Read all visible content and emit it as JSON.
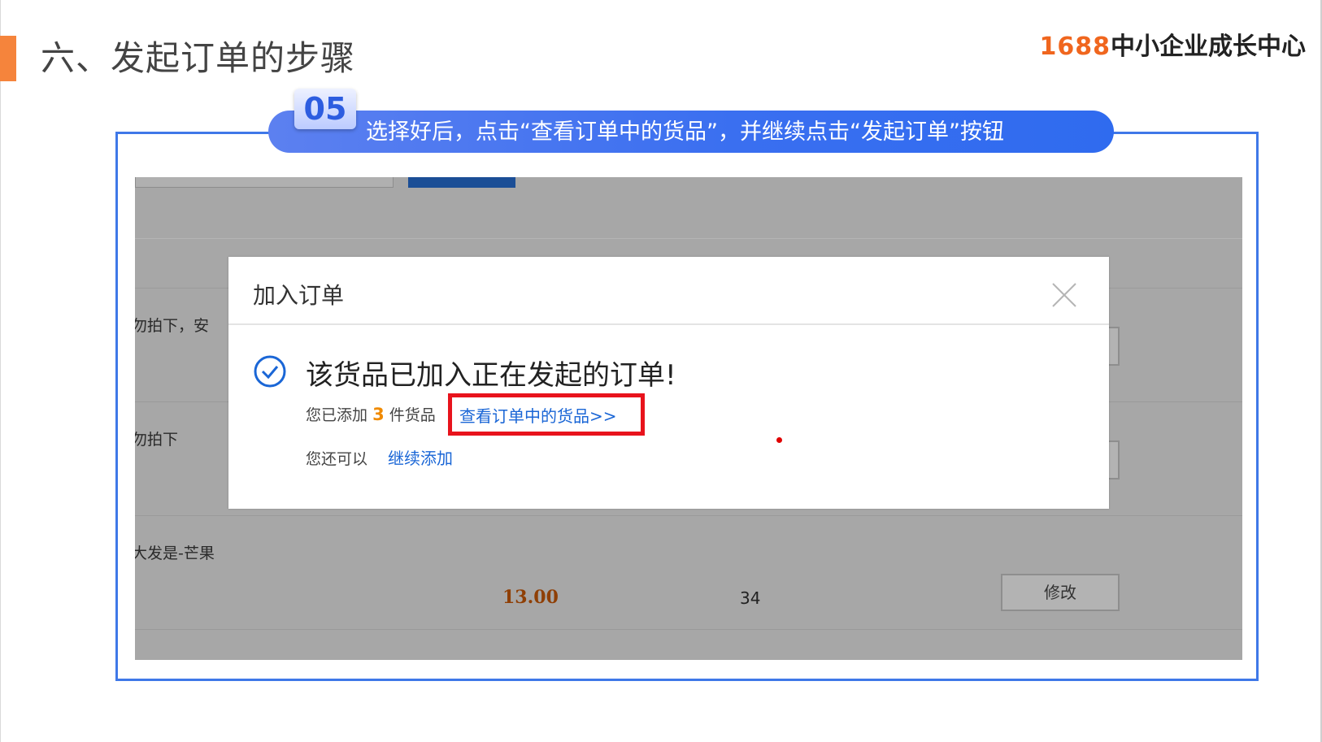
{
  "slide": {
    "title": "六、发起订单的步骤",
    "logo_number": "1688",
    "logo_text": "中小企业成长中心"
  },
  "step": {
    "number": "05",
    "instruction": "选择好后，点击“查看订单中的货品”，并继续点击“发起订单”按钮"
  },
  "background_page": {
    "rows": [
      {
        "name": "勿拍下，安"
      },
      {
        "name": "勿拍下"
      },
      {
        "name": "大发是-芒果",
        "price": "13.00",
        "quantity": "34",
        "edit_button": "修改"
      }
    ]
  },
  "dialog": {
    "title": "加入订单",
    "message": "该货品已加入正在发起的订单!",
    "added_prefix": "您已添加",
    "added_count": "3",
    "added_suffix": "件货品",
    "view_link": "查看订单中的货品>>",
    "also_label": "您还可以",
    "continue_link": "继续添加"
  },
  "colors": {
    "accent_orange": "#f5843c",
    "frame_blue": "#3f78e8",
    "link_blue": "#1a66d6",
    "highlight_red": "#e8131c",
    "overlay_gray": "#a7a7a7"
  }
}
